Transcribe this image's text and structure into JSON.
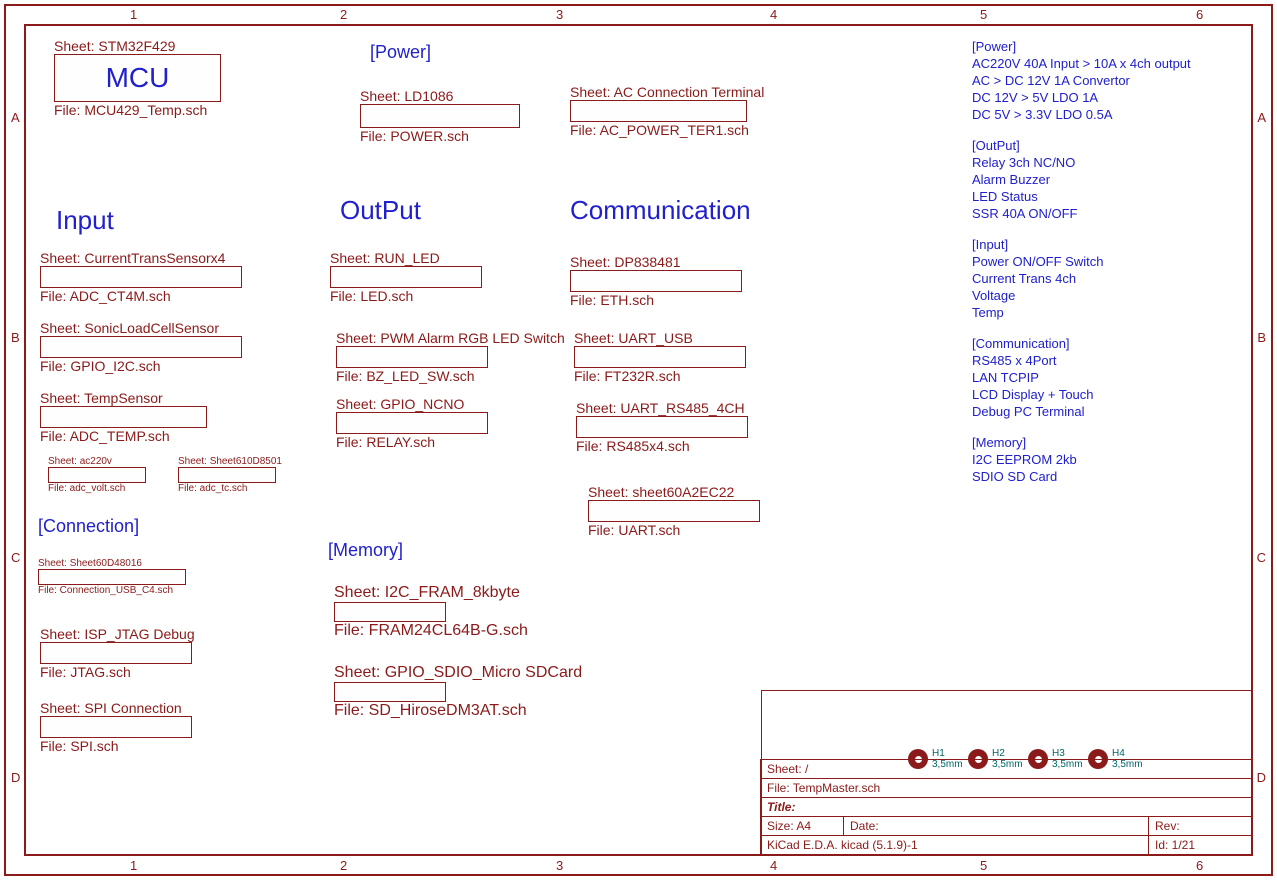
{
  "grid": {
    "cols": [
      "1",
      "2",
      "3",
      "4",
      "5",
      "6"
    ],
    "rows": [
      "A",
      "B",
      "C",
      "D"
    ]
  },
  "mcu": {
    "sheet": "Sheet: STM32F429",
    "label": "MCU",
    "file": "File: MCU429_Temp.sch"
  },
  "power_hdr": "[Power]",
  "power_ld": {
    "sheet": "Sheet: LD1086",
    "file": "File: POWER.sch"
  },
  "power_ac": {
    "sheet": "Sheet: AC Connection Terminal",
    "file": "File: AC_POWER_TER1.sch"
  },
  "input_hdr": "Input",
  "input1": {
    "sheet": "Sheet: CurrentTransSensorx4",
    "file": "File: ADC_CT4M.sch"
  },
  "input2": {
    "sheet": "Sheet: SonicLoadCellSensor",
    "file": "File: GPIO_I2C.sch"
  },
  "input3": {
    "sheet": "Sheet: TempSensor",
    "file": "File: ADC_TEMP.sch"
  },
  "input4": {
    "sheet": "Sheet: ac220v",
    "file": "File: adc_volt.sch"
  },
  "input5": {
    "sheet": "Sheet: Sheet610D8501",
    "file": "File: adc_tc.sch"
  },
  "output_hdr": "OutPut",
  "out1": {
    "sheet": "Sheet: RUN_LED",
    "file": "File: LED.sch"
  },
  "out2": {
    "sheet": "Sheet: PWM Alarm RGB LED Switch",
    "file": "File: BZ_LED_SW.sch"
  },
  "out3": {
    "sheet": "Sheet: GPIO_NCNO",
    "file": "File: RELAY.sch"
  },
  "comm_hdr": "Communication",
  "comm1": {
    "sheet": "Sheet: DP838481",
    "file": "File: ETH.sch"
  },
  "comm2": {
    "sheet": "Sheet: UART_USB",
    "file": "File: FT232R.sch"
  },
  "comm3": {
    "sheet": "Sheet: UART_RS485_4CH",
    "file": "File: RS485x4.sch"
  },
  "comm4": {
    "sheet": "Sheet: sheet60A2EC22",
    "file": "File: UART.sch"
  },
  "conn_hdr": "[Connection]",
  "conn1": {
    "sheet": "Sheet: Sheet60D48016",
    "file": "File: Connection_USB_C4.sch"
  },
  "conn2": {
    "sheet": "Sheet: ISP_JTAG Debug",
    "file": "File: JTAG.sch"
  },
  "conn3": {
    "sheet": "Sheet: SPI Connection",
    "file": "File: SPI.sch"
  },
  "mem_hdr": "[Memory]",
  "mem1": {
    "sheet": "Sheet: I2C_FRAM_8kbyte",
    "file": "File: FRAM24CL64B-G.sch"
  },
  "mem2": {
    "sheet": "Sheet: GPIO_SDIO_Micro SDCard",
    "file": "File: SD_HiroseDM3AT.sch"
  },
  "notes": {
    "power_h": "[Power]",
    "power": [
      "AC220V 40A Input > 10A x 4ch output",
      "AC > DC 12V 1A Convertor",
      "DC 12V > 5V LDO 1A",
      "DC 5V > 3.3V LDO 0.5A"
    ],
    "output_h": "[OutPut]",
    "output": [
      "Relay 3ch NC/NO",
      "Alarm Buzzer",
      "LED Status",
      "SSR 40A ON/OFF"
    ],
    "input_h": "[Input]",
    "input": [
      "Power ON/OFF Switch",
      "Current Trans 4ch",
      "Voltage",
      "Temp"
    ],
    "comm_h": "[Communication]",
    "comm": [
      "RS485 x 4Port",
      "LAN TCPIP",
      "LCD Display + Touch",
      "Debug PC Terminal"
    ],
    "mem_h": "[Memory]",
    "mem": [
      "I2C EEPROM 2kb",
      "SDIO SD Card"
    ]
  },
  "holes": [
    {
      "ref": "H1",
      "val": "3,5mm"
    },
    {
      "ref": "H2",
      "val": "3,5mm"
    },
    {
      "ref": "H3",
      "val": "3,5mm"
    },
    {
      "ref": "H4",
      "val": "3,5mm"
    }
  ],
  "title_block": {
    "sheet": "Sheet: /",
    "file": "File: TempMaster.sch",
    "title_label": "Title:",
    "size_label": "Size: A4",
    "date_label": "Date:",
    "rev_label": "Rev:",
    "tool": "KiCad E.D.A.  kicad (5.1.9)-1",
    "id": "Id: 1/21"
  }
}
